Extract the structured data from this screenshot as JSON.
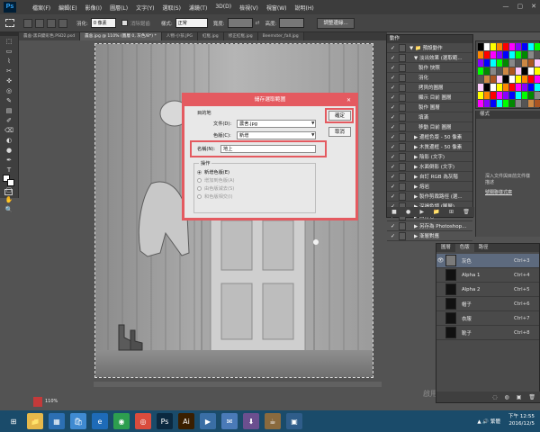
{
  "app": {
    "logo": "Ps",
    "menus": [
      "檔案(F)",
      "編輯(E)",
      "影像(I)",
      "圖層(L)",
      "文字(Y)",
      "選取(S)",
      "濾鏡(T)",
      "3D(D)",
      "檢視(V)",
      "視窗(W)",
      "說明(H)"
    ],
    "window_buttons": [
      "—",
      "▢",
      "✕"
    ]
  },
  "options_bar": {
    "feather_label": "羽化:",
    "feather_value": "0 像素",
    "antialias_label": "消除鋸齒",
    "style_label": "樣式:",
    "style_value": "正常",
    "width_label": "寬度:",
    "height_label": "高度:",
    "refine_button": "調整邊緣..."
  },
  "tabs": [
    {
      "label": "農舍-黑白變彩色.PSD2.psd",
      "active": false
    },
    {
      "label": "農舍.jpg @ 110% (圖層 0, 灰色/8*) *",
      "active": true
    },
    {
      "label": "人物-小孩.JPG",
      "active": false
    },
    {
      "label": "紅框.jpg",
      "active": false
    },
    {
      "label": "修正紅框.jpg",
      "active": false
    },
    {
      "label": "Beemster_fall.jpg",
      "active": false
    }
  ],
  "tools": [
    "⬚",
    "▭",
    "⌇",
    "✂",
    "✜",
    "◎",
    "✎",
    "▤",
    "✐",
    "⌫",
    "◐",
    "●",
    "✒",
    "T",
    "↖",
    "▢",
    "✋",
    "🔍"
  ],
  "colors": {
    "accent": "#e45a60",
    "dialog_bg": "#e8e8e8",
    "panel_bg": "#4a4a4a",
    "taskbar": "#1a4b6a"
  },
  "dialog": {
    "title": "儲存選取範圍",
    "close_icon": "✕",
    "destination_label": "目的地",
    "document_label": "文件(D):",
    "document_value": "農舍.jpg",
    "channel_label": "色版(C):",
    "channel_value": "新增",
    "name_label": "名稱(N):",
    "name_value": "地上",
    "operation_label": "操作",
    "operations": [
      {
        "label": "新增色版(E)",
        "checked": true
      },
      {
        "label": "增加到色版(A)",
        "checked": false
      },
      {
        "label": "由色版減去(S)",
        "checked": false
      },
      {
        "label": "和色版相交(I)",
        "checked": false
      }
    ],
    "ok_button": "確定",
    "cancel_button": "取消"
  },
  "actions_panel": {
    "title": "動作",
    "items": [
      {
        "text": "▼ 📁 預設動作",
        "indent": 0
      },
      {
        "text": "▼ 淡出效果 (選取範...",
        "indent": 1
      },
      {
        "text": "製作 快照",
        "indent": 2
      },
      {
        "text": "羽化",
        "indent": 2
      },
      {
        "text": "拷貝的圖層",
        "indent": 2
      },
      {
        "text": "顯示 目前 圖層",
        "indent": 2
      },
      {
        "text": "製作 圖層",
        "indent": 2
      },
      {
        "text": "填滿",
        "indent": 2
      },
      {
        "text": "移動 目前 圖層",
        "indent": 2
      },
      {
        "text": "▶ 邊框色版 - 50 像素",
        "indent": 1
      },
      {
        "text": "▶ 木質邊框 - 50 像素",
        "indent": 1
      },
      {
        "text": "▶ 陰影 (文字)",
        "indent": 1
      },
      {
        "text": "▶ 水面倒影 (文字)",
        "indent": 1
      },
      {
        "text": "▶ 自訂 RGB 為灰階",
        "indent": 1
      },
      {
        "text": "▶ 熔岩",
        "indent": 1
      },
      {
        "text": "▶ 製作剪裁路徑 (選...",
        "indent": 1
      },
      {
        "text": "▶ 深褐色調 (圖層)",
        "indent": 1
      },
      {
        "text": "▶ 四分色",
        "indent": 1
      },
      {
        "text": "▶ 另存為 Photoshop...",
        "indent": 1
      },
      {
        "text": "▶ 漸層對應",
        "indent": 1
      }
    ],
    "footer_icons": [
      "■",
      "●",
      "▶",
      "📁",
      "⊞",
      "🗑"
    ]
  },
  "side_panel": {
    "tab_label": "樣式",
    "text_lines": [
      "深入文件與目前文件樣",
      "描述"
    ],
    "link_text": "號關聯樣式庫"
  },
  "channels_panel": {
    "tabs": [
      "圖層",
      "色版",
      "路徑"
    ],
    "rows": [
      {
        "name": "灰色",
        "key": "Ctrl+3",
        "visible": true,
        "selected": true,
        "thumb": "#7a7a7a"
      },
      {
        "name": "Alpha 1",
        "key": "Ctrl+4",
        "visible": false,
        "selected": false,
        "thumb": "#111111"
      },
      {
        "name": "Alpha 2",
        "key": "Ctrl+5",
        "visible": false,
        "selected": false,
        "thumb": "#111111"
      },
      {
        "name": "帽子",
        "key": "Ctrl+6",
        "visible": false,
        "selected": false,
        "thumb": "#111111"
      },
      {
        "name": "衣服",
        "key": "Ctrl+7",
        "visible": false,
        "selected": false,
        "thumb": "#111111"
      },
      {
        "name": "靴子",
        "key": "Ctrl+8",
        "visible": false,
        "selected": false,
        "thumb": "#111111"
      }
    ],
    "footer_icons": [
      "◌",
      "◍",
      "▣",
      "🗑"
    ]
  },
  "status": {
    "zoom": "110%",
    "watermark": "啟用"
  },
  "taskbar": {
    "apps": [
      {
        "icon": "⊞",
        "bg": "#1a4b6a"
      },
      {
        "icon": "📁",
        "bg": "#e6b84a"
      },
      {
        "icon": "▦",
        "bg": "#2c6fb3"
      },
      {
        "icon": "🛍",
        "bg": "#3f8ad1"
      },
      {
        "icon": "e",
        "bg": "#1e6bb8"
      },
      {
        "icon": "◉",
        "bg": "#2d9e4f"
      },
      {
        "icon": "◎",
        "bg": "#d94c3d"
      },
      {
        "icon": "Ps",
        "bg": "#0b2940"
      },
      {
        "icon": "Ai",
        "bg": "#3a1f00"
      },
      {
        "icon": "▶",
        "bg": "#3a6ea5"
      },
      {
        "icon": "✉",
        "bg": "#4a7ab8"
      },
      {
        "icon": "⬇",
        "bg": "#6b4f8f"
      },
      {
        "icon": "☕",
        "bg": "#8a6a3e"
      },
      {
        "icon": "▣",
        "bg": "#2f5d8a"
      }
    ],
    "tray": "▲ 🔊 繁體",
    "time": "下午 12:55",
    "date": "2016/12/5"
  }
}
